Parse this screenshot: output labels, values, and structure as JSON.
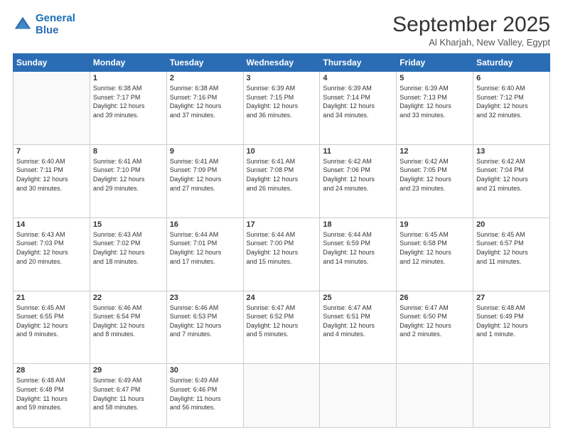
{
  "header": {
    "logo_line1": "General",
    "logo_line2": "Blue",
    "month": "September 2025",
    "location": "Al Kharjah, New Valley, Egypt"
  },
  "weekdays": [
    "Sunday",
    "Monday",
    "Tuesday",
    "Wednesday",
    "Thursday",
    "Friday",
    "Saturday"
  ],
  "weeks": [
    [
      {
        "day": "",
        "info": ""
      },
      {
        "day": "1",
        "info": "Sunrise: 6:38 AM\nSunset: 7:17 PM\nDaylight: 12 hours\nand 39 minutes."
      },
      {
        "day": "2",
        "info": "Sunrise: 6:38 AM\nSunset: 7:16 PM\nDaylight: 12 hours\nand 37 minutes."
      },
      {
        "day": "3",
        "info": "Sunrise: 6:39 AM\nSunset: 7:15 PM\nDaylight: 12 hours\nand 36 minutes."
      },
      {
        "day": "4",
        "info": "Sunrise: 6:39 AM\nSunset: 7:14 PM\nDaylight: 12 hours\nand 34 minutes."
      },
      {
        "day": "5",
        "info": "Sunrise: 6:39 AM\nSunset: 7:13 PM\nDaylight: 12 hours\nand 33 minutes."
      },
      {
        "day": "6",
        "info": "Sunrise: 6:40 AM\nSunset: 7:12 PM\nDaylight: 12 hours\nand 32 minutes."
      }
    ],
    [
      {
        "day": "7",
        "info": "Sunrise: 6:40 AM\nSunset: 7:11 PM\nDaylight: 12 hours\nand 30 minutes."
      },
      {
        "day": "8",
        "info": "Sunrise: 6:41 AM\nSunset: 7:10 PM\nDaylight: 12 hours\nand 29 minutes."
      },
      {
        "day": "9",
        "info": "Sunrise: 6:41 AM\nSunset: 7:09 PM\nDaylight: 12 hours\nand 27 minutes."
      },
      {
        "day": "10",
        "info": "Sunrise: 6:41 AM\nSunset: 7:08 PM\nDaylight: 12 hours\nand 26 minutes."
      },
      {
        "day": "11",
        "info": "Sunrise: 6:42 AM\nSunset: 7:06 PM\nDaylight: 12 hours\nand 24 minutes."
      },
      {
        "day": "12",
        "info": "Sunrise: 6:42 AM\nSunset: 7:05 PM\nDaylight: 12 hours\nand 23 minutes."
      },
      {
        "day": "13",
        "info": "Sunrise: 6:42 AM\nSunset: 7:04 PM\nDaylight: 12 hours\nand 21 minutes."
      }
    ],
    [
      {
        "day": "14",
        "info": "Sunrise: 6:43 AM\nSunset: 7:03 PM\nDaylight: 12 hours\nand 20 minutes."
      },
      {
        "day": "15",
        "info": "Sunrise: 6:43 AM\nSunset: 7:02 PM\nDaylight: 12 hours\nand 18 minutes."
      },
      {
        "day": "16",
        "info": "Sunrise: 6:44 AM\nSunset: 7:01 PM\nDaylight: 12 hours\nand 17 minutes."
      },
      {
        "day": "17",
        "info": "Sunrise: 6:44 AM\nSunset: 7:00 PM\nDaylight: 12 hours\nand 15 minutes."
      },
      {
        "day": "18",
        "info": "Sunrise: 6:44 AM\nSunset: 6:59 PM\nDaylight: 12 hours\nand 14 minutes."
      },
      {
        "day": "19",
        "info": "Sunrise: 6:45 AM\nSunset: 6:58 PM\nDaylight: 12 hours\nand 12 minutes."
      },
      {
        "day": "20",
        "info": "Sunrise: 6:45 AM\nSunset: 6:57 PM\nDaylight: 12 hours\nand 11 minutes."
      }
    ],
    [
      {
        "day": "21",
        "info": "Sunrise: 6:45 AM\nSunset: 6:55 PM\nDaylight: 12 hours\nand 9 minutes."
      },
      {
        "day": "22",
        "info": "Sunrise: 6:46 AM\nSunset: 6:54 PM\nDaylight: 12 hours\nand 8 minutes."
      },
      {
        "day": "23",
        "info": "Sunrise: 6:46 AM\nSunset: 6:53 PM\nDaylight: 12 hours\nand 7 minutes."
      },
      {
        "day": "24",
        "info": "Sunrise: 6:47 AM\nSunset: 6:52 PM\nDaylight: 12 hours\nand 5 minutes."
      },
      {
        "day": "25",
        "info": "Sunrise: 6:47 AM\nSunset: 6:51 PM\nDaylight: 12 hours\nand 4 minutes."
      },
      {
        "day": "26",
        "info": "Sunrise: 6:47 AM\nSunset: 6:50 PM\nDaylight: 12 hours\nand 2 minutes."
      },
      {
        "day": "27",
        "info": "Sunrise: 6:48 AM\nSunset: 6:49 PM\nDaylight: 12 hours\nand 1 minute."
      }
    ],
    [
      {
        "day": "28",
        "info": "Sunrise: 6:48 AM\nSunset: 6:48 PM\nDaylight: 11 hours\nand 59 minutes."
      },
      {
        "day": "29",
        "info": "Sunrise: 6:49 AM\nSunset: 6:47 PM\nDaylight: 11 hours\nand 58 minutes."
      },
      {
        "day": "30",
        "info": "Sunrise: 6:49 AM\nSunset: 6:46 PM\nDaylight: 11 hours\nand 56 minutes."
      },
      {
        "day": "",
        "info": ""
      },
      {
        "day": "",
        "info": ""
      },
      {
        "day": "",
        "info": ""
      },
      {
        "day": "",
        "info": ""
      }
    ]
  ]
}
